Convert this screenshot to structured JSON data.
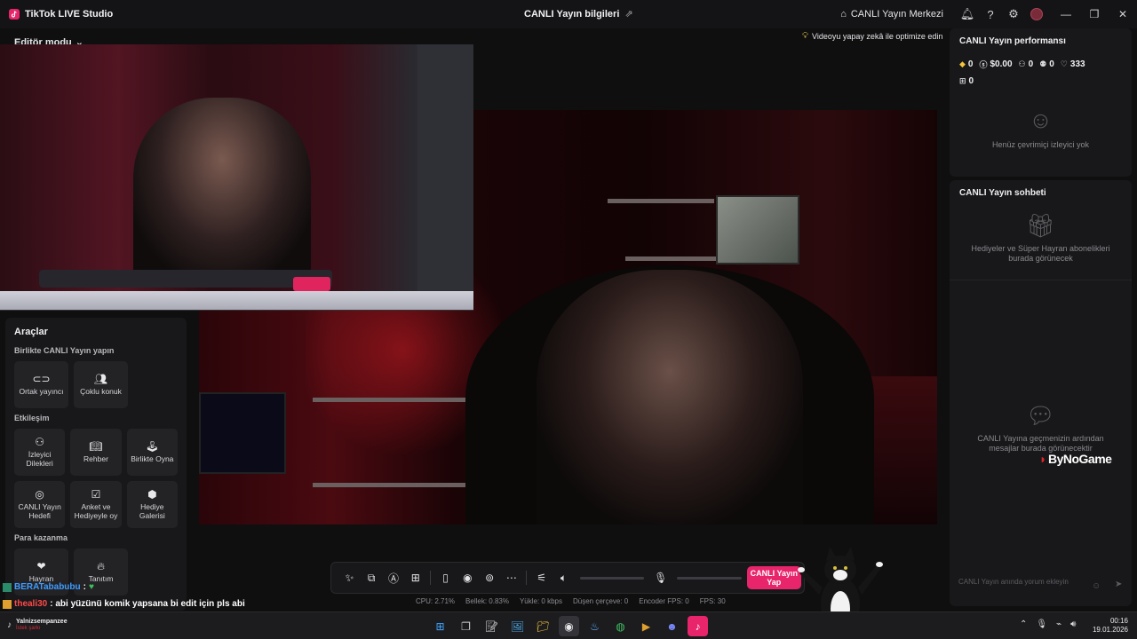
{
  "titlebar": {
    "app_title": "TikTok LIVE Studio",
    "center_title": "CANLI Yayın bilgileri",
    "hub_label": "CANLI Yayın Merkezi"
  },
  "left": {
    "editor_mode": "Editör modu",
    "tools": {
      "title": "Araçlar",
      "sections": [
        {
          "title": "Birlikte CANLI Yayın yapın",
          "items": [
            "Ortak yayıncı",
            "Çoklu konuk"
          ]
        },
        {
          "title": "Etkileşim",
          "items": [
            "İzleyici Dilekleri",
            "Rehber",
            "Birlikte Oyna",
            "CANLI Yayın Hedefi",
            "Anket ve Hediyeyle oy",
            "Hediye Galerisi"
          ]
        },
        {
          "title": "Para kazanma",
          "items": [
            "Hayran",
            "Tanıtım"
          ]
        }
      ]
    }
  },
  "ai_chip": "Videoyu yapay zekâ ile optimize edin",
  "performance": {
    "title": "CANLI Yayın performansı",
    "stats": {
      "diamonds": "0",
      "earnings": "$0.00",
      "viewers": "0",
      "new_followers": "0",
      "likes": "333",
      "gifters": "0"
    },
    "empty_text": "Henüz çevrimiçi izleyici yok"
  },
  "chat": {
    "title": "CANLI Yayın sohbeti",
    "gifts_empty": "Hediyeler ve Süper Hayran abonelikleri burada görünecek",
    "chat_empty": "CANLI Yayına geçmenizin ardından mesajlar burada görünecektir",
    "input_placeholder": "CANLI Yayın anında yorum ekleyin"
  },
  "watermark": "ByNoGame",
  "controls": {
    "go_live": "CANLI Yayın Yap",
    "volume_level": 0.0,
    "mic_level": 0.0
  },
  "status": {
    "cpu": "CPU: 2.71%",
    "memory": "Bellek: 0.83%",
    "upload": "Yükle: 0 kbps",
    "dropped": "Düşen çerçeve: 0",
    "encoder_fps": "Encoder FPS: 0",
    "fps": "FPS: 30"
  },
  "stream_chat": [
    {
      "user": "BERATababubu",
      "message": ":"
    },
    {
      "user": "theali30",
      "message": ": abi yüzünü komik yapsana bi edit için pls abi"
    }
  ],
  "taskbar": {
    "song_title": "Yalnizsempanzee",
    "song_sub": "İstek şarkı",
    "time": "00:16",
    "date": "19.01.2026"
  },
  "colors": {
    "accent": "#e8246a",
    "panel": "#18181a",
    "background": "#0f0f10"
  }
}
